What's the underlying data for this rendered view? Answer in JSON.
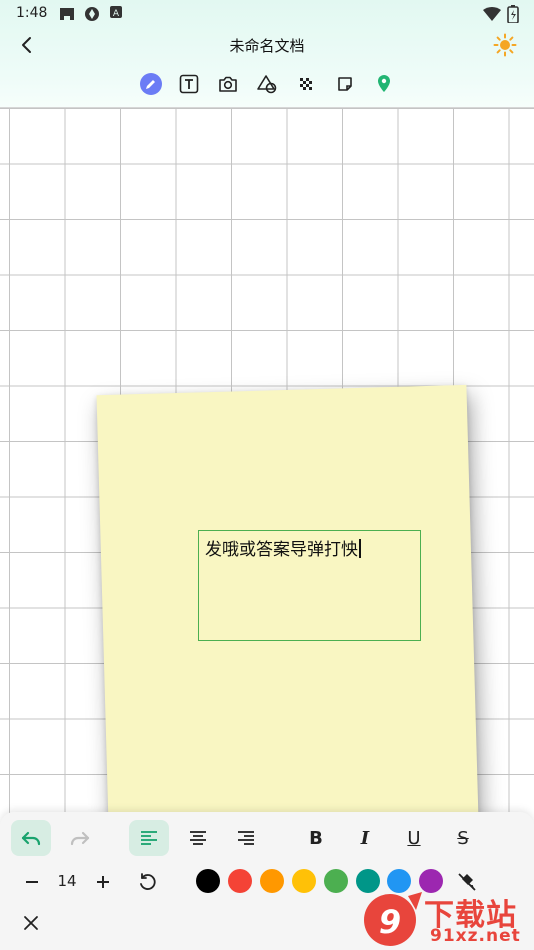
{
  "status_bar": {
    "time": "1:48",
    "left_icons": [
      "game-controller-icon",
      "shutter-icon",
      "font-a-icon"
    ],
    "right_icons": [
      "wifi-icon",
      "battery-icon"
    ]
  },
  "header": {
    "title": "未命名文档",
    "back_icon": "chevron-left-icon",
    "theme_icon": "sun-icon",
    "accent": "#f5a623"
  },
  "toolbar": {
    "active": "pen",
    "active_color": "#6b7cf5",
    "tools": [
      "pen-icon",
      "text-icon",
      "camera-icon",
      "shapes-icon",
      "mosaic-icon",
      "sticky-note-icon",
      "location-pin-icon"
    ]
  },
  "canvas": {
    "sticky_note_color": "#f9f6c2",
    "text_box": {
      "text": "发哦或答案导弹打怏",
      "border_color": "#4caf50"
    }
  },
  "format_panel": {
    "undo_active": true,
    "alignment": "left",
    "font_size": "14",
    "formats": [
      "bold-icon",
      "italic-icon",
      "underline-icon",
      "strikethrough-icon"
    ],
    "bold_label": "B",
    "italic_label": "I",
    "underline_label": "U",
    "strike_label": "S",
    "colors": [
      "#000000",
      "#f44336",
      "#ff9800",
      "#ffc107",
      "#4caf50",
      "#009688",
      "#2196f3",
      "#9c27b0"
    ]
  },
  "watermark": {
    "text_top": "下载站",
    "text_bottom": "91xz.net"
  }
}
